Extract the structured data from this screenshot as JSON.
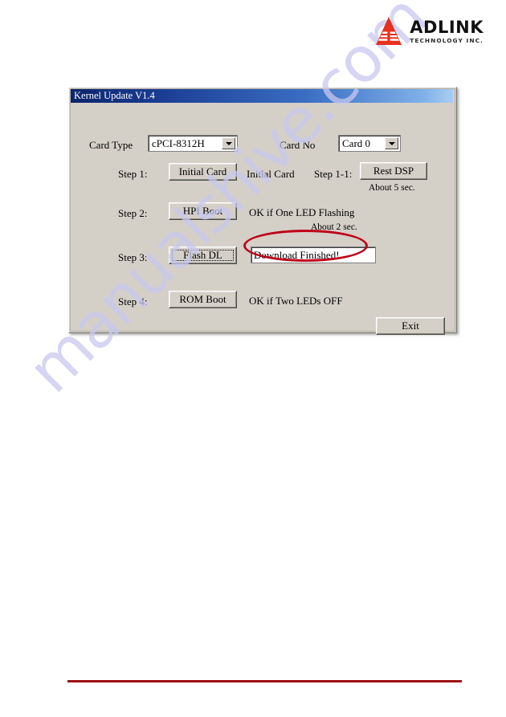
{
  "brand": {
    "name": "ADLINK",
    "sub": "TECHNOLOGY INC.",
    "mark_color": "#e8301f",
    "name_color": "#111111"
  },
  "watermark": {
    "text": "manualshive.com",
    "color": "#c9c8ef"
  },
  "dialog": {
    "title": "Kernel Update V1.4",
    "title_bar_color_start": "#0b246a",
    "title_bar_color_end": "#a9cdf2",
    "face_color": "#d4d0c8",
    "card_type": {
      "label": "Card Type",
      "value": "cPCI-8312H"
    },
    "card_no": {
      "label": "Card No",
      "value": "Card 0"
    },
    "step1": {
      "label": "Step 1:",
      "button": "Initial Card",
      "note": "Initial Card"
    },
    "step1_1": {
      "label": "Step 1-1:",
      "button": "Rest DSP",
      "note": "About 5 sec."
    },
    "step2": {
      "label": "Step 2:",
      "button": "HPI Boot",
      "note": "OK if One LED Flashing",
      "note2": "About 2 sec."
    },
    "step3": {
      "label": "Step 3:",
      "button": "Flash DL",
      "status_value": "Download Finished!"
    },
    "step4": {
      "label": "Step 4:",
      "button": "ROM Boot",
      "note": "OK if Two LEDs OFF"
    },
    "exit_button": "Exit"
  },
  "annotation": {
    "ellipse_color": "#c00018"
  },
  "footer": {
    "rule_color": "#9e1115"
  }
}
